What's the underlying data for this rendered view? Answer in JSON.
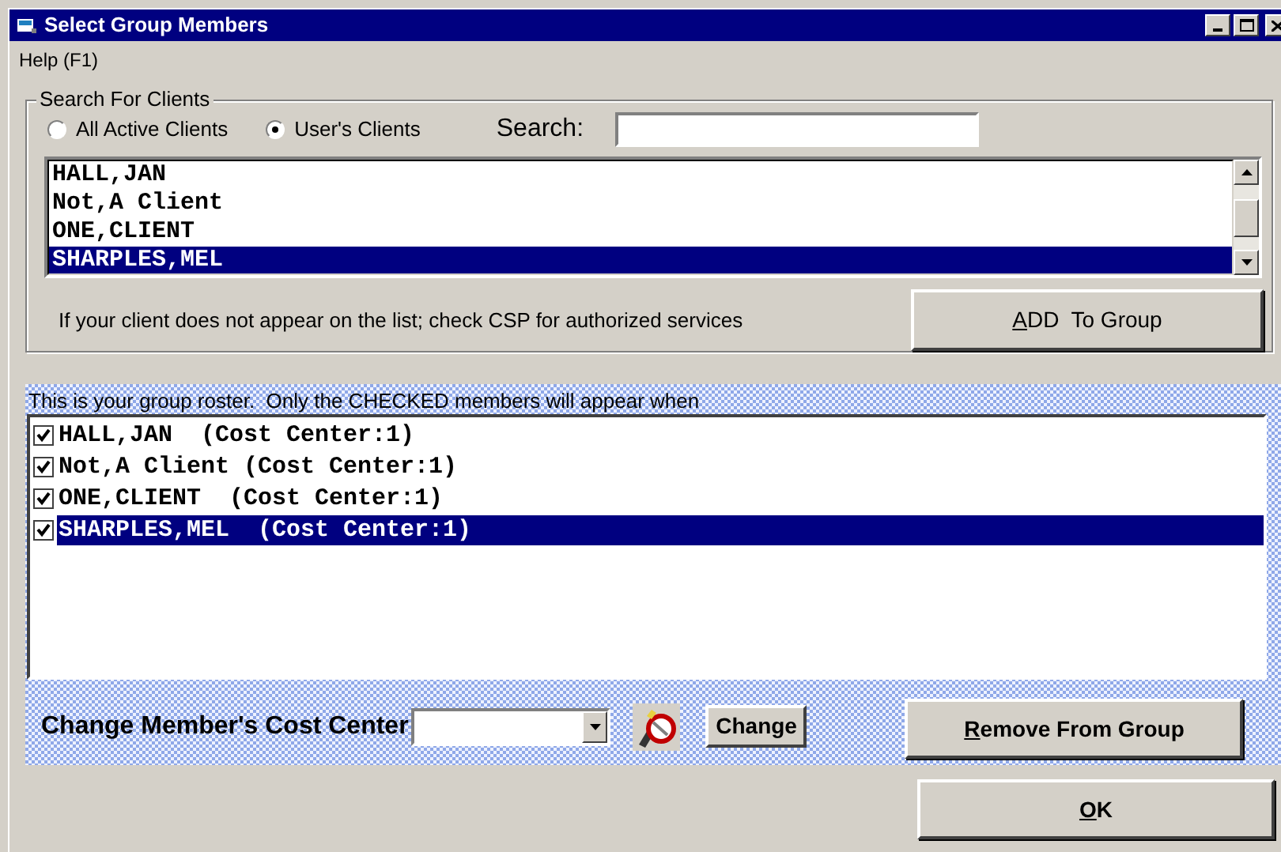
{
  "window": {
    "title": "Select Group Members"
  },
  "menu": [
    {
      "label": "Help (F1)"
    }
  ],
  "search_group": {
    "title": "Search For Clients",
    "radios": [
      {
        "label": "All Active Clients",
        "selected": false
      },
      {
        "label": "User's Clients",
        "selected": true
      }
    ],
    "search": {
      "label": "Search:"
    },
    "clients": [
      {
        "name": "HALL,JAN",
        "selected": false
      },
      {
        "name": "Not,A Client",
        "selected": false
      },
      {
        "name": "ONE,CLIENT",
        "selected": false
      },
      {
        "name": "SHARPLES,MEL",
        "selected": true
      }
    ],
    "note": "If your client does not appear on the list; check CSP for authorized services",
    "add_button": {
      "mnemonic": "A",
      "rest": "DD  To Group"
    }
  },
  "roster": {
    "caption": "This is your group roster.  Only the CHECKED members will appear when",
    "members": [
      {
        "label": "HALL,JAN  (Cost Center:1)",
        "checked": true,
        "selected": false
      },
      {
        "label": "Not,A Client (Cost Center:1)",
        "checked": true,
        "selected": false
      },
      {
        "label": "ONE,CLIENT  (Cost Center:1)",
        "checked": true,
        "selected": false
      },
      {
        "label": "SHARPLES,MEL  (Cost Center:1)",
        "checked": true,
        "selected": true
      }
    ],
    "cost_center_label": "Change Member's Cost Center",
    "change_button": {
      "label": "Change"
    },
    "remove_button": {
      "mnemonic": "R",
      "rest": "emove From Group"
    }
  },
  "ok_button": {
    "mnemonic": "O",
    "rest": "K"
  }
}
